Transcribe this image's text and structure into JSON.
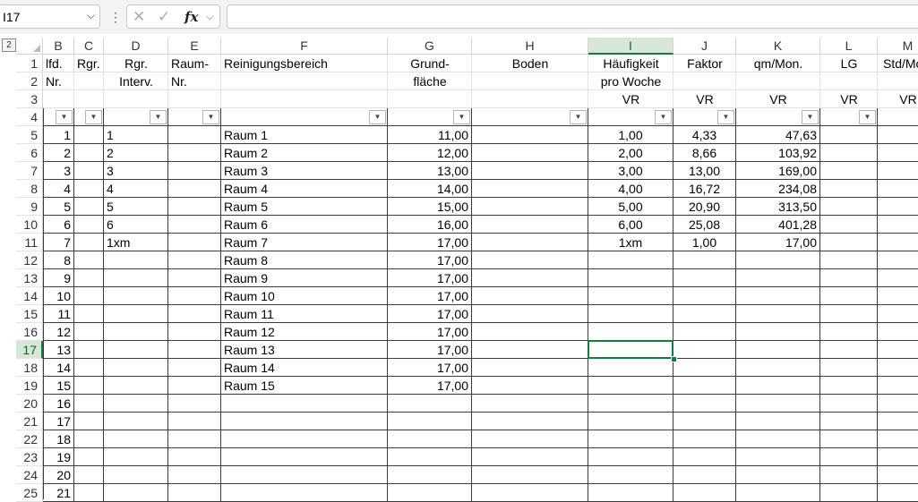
{
  "formula_bar": {
    "name_box": "I17",
    "fx_label": "fx",
    "cancel_icon": "close-icon",
    "enter_icon": "check-icon",
    "formula": ""
  },
  "outline_level_button": "2",
  "columns": [
    {
      "id": "B",
      "selected": false
    },
    {
      "id": "C",
      "selected": false
    },
    {
      "id": "D",
      "selected": false
    },
    {
      "id": "E",
      "selected": false
    },
    {
      "id": "F",
      "selected": false
    },
    {
      "id": "G",
      "selected": false
    },
    {
      "id": "H",
      "selected": false
    },
    {
      "id": "I",
      "selected": true
    },
    {
      "id": "J",
      "selected": false
    },
    {
      "id": "K",
      "selected": false
    },
    {
      "id": "L",
      "selected": false
    },
    {
      "id": "M",
      "selected": false
    }
  ],
  "selected_cell": "I17",
  "rows": [
    {
      "n": "1",
      "cells": {
        "B": "lfd.",
        "C": "Rgr.",
        "D": "Rgr.",
        "E": "Raum-",
        "F": "Reinigungsbereich",
        "G": "Grund-",
        "H": "Boden",
        "I": "Häufigkeit",
        "J": "Faktor",
        "K": "qm/Mon.",
        "L": "LG",
        "M": "Std/Mon."
      }
    },
    {
      "n": "2",
      "cells": {
        "B": "Nr.",
        "D": "Interv.",
        "E": "Nr.",
        "G": "fläche",
        "I": "pro Woche"
      }
    },
    {
      "n": "3",
      "cells": {
        "I": "VR",
        "J": "VR",
        "K": "VR",
        "L": "VR",
        "M": "VR"
      }
    },
    {
      "n": "4",
      "filter": true,
      "cells": {}
    },
    {
      "n": "5",
      "cells": {
        "B": "1",
        "D": "1",
        "F": "Raum 1",
        "G": "11,00",
        "I": "1,00",
        "J": "4,33",
        "K": "47,63"
      }
    },
    {
      "n": "6",
      "cells": {
        "B": "2",
        "D": "2",
        "F": "Raum 2",
        "G": "12,00",
        "I": "2,00",
        "J": "8,66",
        "K": "103,92"
      }
    },
    {
      "n": "7",
      "cells": {
        "B": "3",
        "D": "3",
        "F": "Raum 3",
        "G": "13,00",
        "I": "3,00",
        "J": "13,00",
        "K": "169,00"
      }
    },
    {
      "n": "8",
      "cells": {
        "B": "4",
        "D": "4",
        "F": "Raum 4",
        "G": "14,00",
        "I": "4,00",
        "J": "16,72",
        "K": "234,08"
      }
    },
    {
      "n": "9",
      "cells": {
        "B": "5",
        "D": "5",
        "F": "Raum 5",
        "G": "15,00",
        "I": "5,00",
        "J": "20,90",
        "K": "313,50"
      }
    },
    {
      "n": "10",
      "cells": {
        "B": "6",
        "D": "6",
        "F": "Raum 6",
        "G": "16,00",
        "I": "6,00",
        "J": "25,08",
        "K": "401,28"
      }
    },
    {
      "n": "11",
      "cells": {
        "B": "7",
        "D": "1xm",
        "F": "Raum 7",
        "G": "17,00",
        "I": "1xm",
        "J": "1,00",
        "K": "17,00"
      }
    },
    {
      "n": "12",
      "cells": {
        "B": "8",
        "F": "Raum 8",
        "G": "17,00"
      }
    },
    {
      "n": "13",
      "cells": {
        "B": "9",
        "F": "Raum 9",
        "G": "17,00"
      }
    },
    {
      "n": "14",
      "cells": {
        "B": "10",
        "F": "Raum 10",
        "G": "17,00"
      }
    },
    {
      "n": "15",
      "cells": {
        "B": "11",
        "F": "Raum 11",
        "G": "17,00"
      }
    },
    {
      "n": "16",
      "cells": {
        "B": "12",
        "F": "Raum 12",
        "G": "17,00"
      }
    },
    {
      "n": "17",
      "cells": {
        "B": "13",
        "F": "Raum 13",
        "G": "17,00"
      }
    },
    {
      "n": "18",
      "cells": {
        "B": "14",
        "F": "Raum 14",
        "G": "17,00"
      }
    },
    {
      "n": "19",
      "cells": {
        "B": "15",
        "F": "Raum 15",
        "G": "17,00"
      }
    },
    {
      "n": "20",
      "cells": {
        "B": "16"
      }
    },
    {
      "n": "21",
      "cells": {
        "B": "17"
      }
    },
    {
      "n": "22",
      "cells": {
        "B": "18"
      }
    },
    {
      "n": "23",
      "cells": {
        "B": "19"
      }
    },
    {
      "n": "24",
      "cells": {
        "B": "20"
      }
    },
    {
      "n": "25",
      "cells": {
        "B": "21"
      }
    }
  ]
}
